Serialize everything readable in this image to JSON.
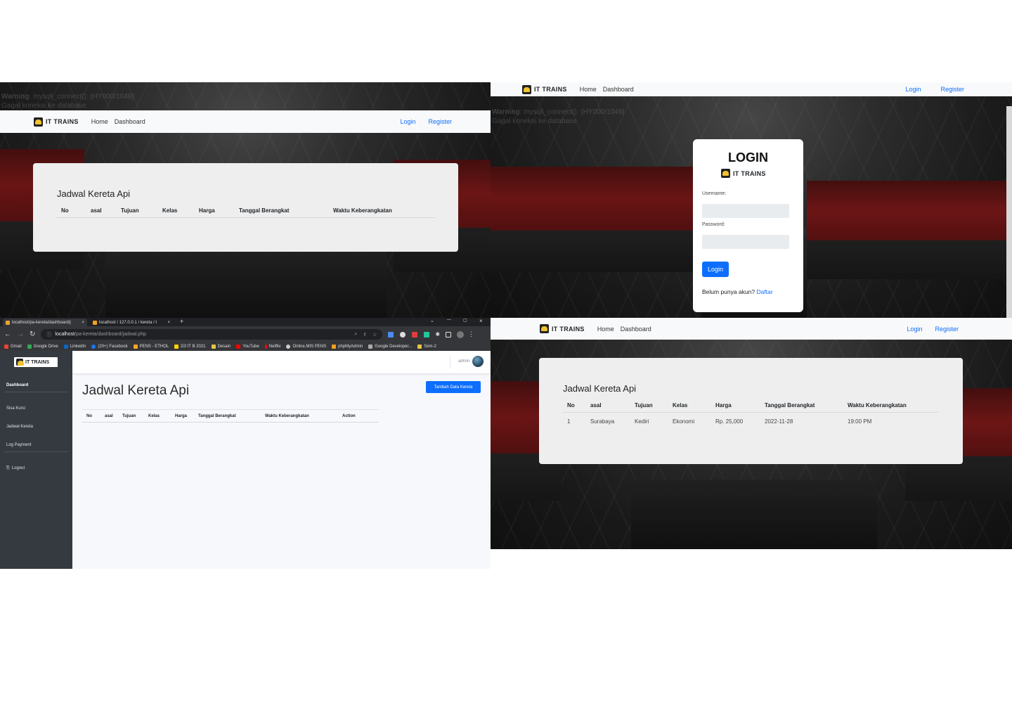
{
  "brand": "IT TRAINS",
  "nav": {
    "home": "Home",
    "dashboard": "Dashboard",
    "login": "Login",
    "register": "Register"
  },
  "warning": {
    "prefix": "Warning",
    "text": ": mysqli_connect(): (HY000/1049)",
    "line2": "Gagal koneksi ke database"
  },
  "schedule": {
    "title": "Jadwal Kereta Api",
    "columns": [
      "No",
      "asal",
      "Tujuan",
      "Kelas",
      "Harga",
      "Tanggal Berangkat",
      "Waktu Keberangkatan"
    ],
    "rows": [
      {
        "no": "1",
        "asal": "Surabaya",
        "tujuan": "Kediri",
        "kelas": "Ekonomi",
        "harga": "Rp. 25,000",
        "tanggal": "2022-11-28",
        "waktu": "19:00 PM"
      }
    ]
  },
  "login": {
    "title": "LOGIN",
    "username_label": "Username:",
    "password_label": "Password:",
    "button": "Login",
    "signup_prompt": "Belum punya akun?",
    "signup_link": "Daftar"
  },
  "browser": {
    "tab1": "localhost/pa-kereta/dashboard/j",
    "tab2": "localhost / 127.0.0.1 / kereta / t",
    "url_host": "localhost",
    "url_path": "/pa-kereta/dashboard/jadwal.php",
    "bookmarks": [
      "Gmail",
      "Google Drive",
      "LinkedIn",
      "(20+) Facebook",
      "PENS - ETHOL",
      "D3 IT B 2021",
      "Desain",
      "YouTube",
      "Netflix",
      "Online.MIS PENS",
      "phpMyAdmin",
      "Google Developer...",
      "Sem-2"
    ]
  },
  "admin": {
    "sidebar": [
      "Dashboard",
      "Sisa Kursi",
      "Jadwal Kereta",
      "Log Payment",
      "Logout"
    ],
    "user": "admin",
    "title": "Jadwal Kereta Api",
    "add_button": "Tambah Data Kereta",
    "columns": [
      "No",
      "asal",
      "Tujuan",
      "Kelas",
      "Harga",
      "Tanggal Berangkat",
      "Waktu Keberangkatan",
      "Action"
    ]
  },
  "colors": {
    "primary": "#0d6efd",
    "sidebar": "#343a40",
    "navbar": "#f8f9fa",
    "card": "#eeeeee"
  }
}
